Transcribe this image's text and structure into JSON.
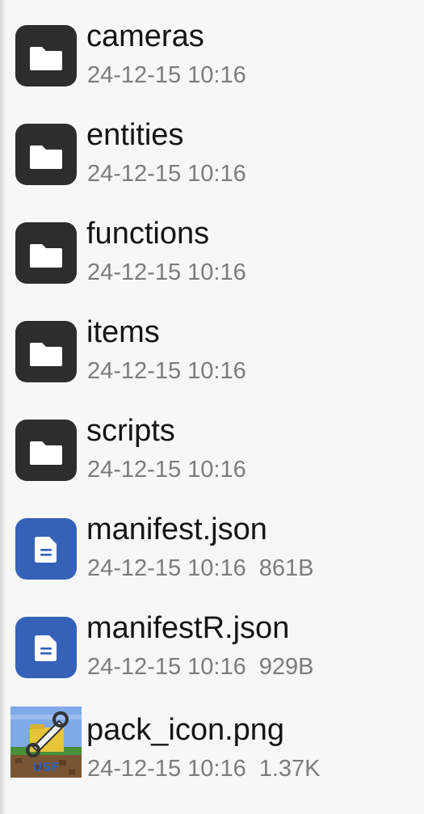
{
  "files": [
    {
      "name": "cameras",
      "date": "24-12-15 10:16",
      "size": "",
      "icon": "folder-icon"
    },
    {
      "name": "entities",
      "date": "24-12-15 10:16",
      "size": "",
      "icon": "folder-icon"
    },
    {
      "name": "functions",
      "date": "24-12-15 10:16",
      "size": "",
      "icon": "folder-icon"
    },
    {
      "name": "items",
      "date": "24-12-15 10:16",
      "size": "",
      "icon": "folder-icon"
    },
    {
      "name": "scripts",
      "date": "24-12-15 10:16",
      "size": "",
      "icon": "folder-icon"
    },
    {
      "name": "manifest.json",
      "date": "24-12-15 10:16",
      "size": "861B",
      "icon": "document-icon"
    },
    {
      "name": "manifestR.json",
      "date": "24-12-15 10:16",
      "size": "929B",
      "icon": "document-icon"
    },
    {
      "name": "pack_icon.png",
      "date": "24-12-15 10:16",
      "size": "1.37K",
      "icon": "image-thumbnail",
      "thumbnail_text": "USF"
    }
  ],
  "colors": {
    "background": "#f7f7f7",
    "folder_icon": "#2d2d2d",
    "document_icon": "#3562b8",
    "name_text": "#141414",
    "meta_text": "#7c7c7c"
  }
}
